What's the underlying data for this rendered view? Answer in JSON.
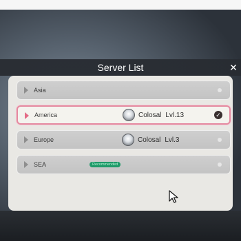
{
  "modal": {
    "title": "Server List",
    "close_glyph": "✕"
  },
  "servers": [
    {
      "name": "Asia",
      "selected": false
    },
    {
      "name": "America",
      "selected": true,
      "character": {
        "name": "Colosal",
        "level": "Lvl.13"
      }
    },
    {
      "name": "Europe",
      "selected": false,
      "character": {
        "name": "Colosal",
        "level": "Lvl.3"
      }
    },
    {
      "name": "SEA",
      "selected": false,
      "badge": "Recommended"
    }
  ],
  "icons": {
    "check": "check-icon",
    "close": "close-icon",
    "row_marker": "triangle-marker-icon",
    "cursor": "cursor-icon"
  },
  "colors": {
    "selected_border": "#e48aa0",
    "badge_bg": "#1f9a69",
    "badge_text": "#b8f3d6"
  }
}
